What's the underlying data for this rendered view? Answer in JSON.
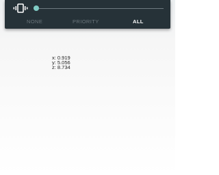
{
  "volume_panel": {
    "icon": "vibrate-icon",
    "slider_level": 0.0,
    "accent_color": "#80cbc4",
    "modes": [
      {
        "label": "NONE",
        "selected": false
      },
      {
        "label": "PRIORITY",
        "selected": false
      },
      {
        "label": "ALL",
        "selected": true
      }
    ]
  },
  "sensor": {
    "x": "x: 0.919",
    "y": "y: 5.056",
    "z": "z: 8.734"
  }
}
